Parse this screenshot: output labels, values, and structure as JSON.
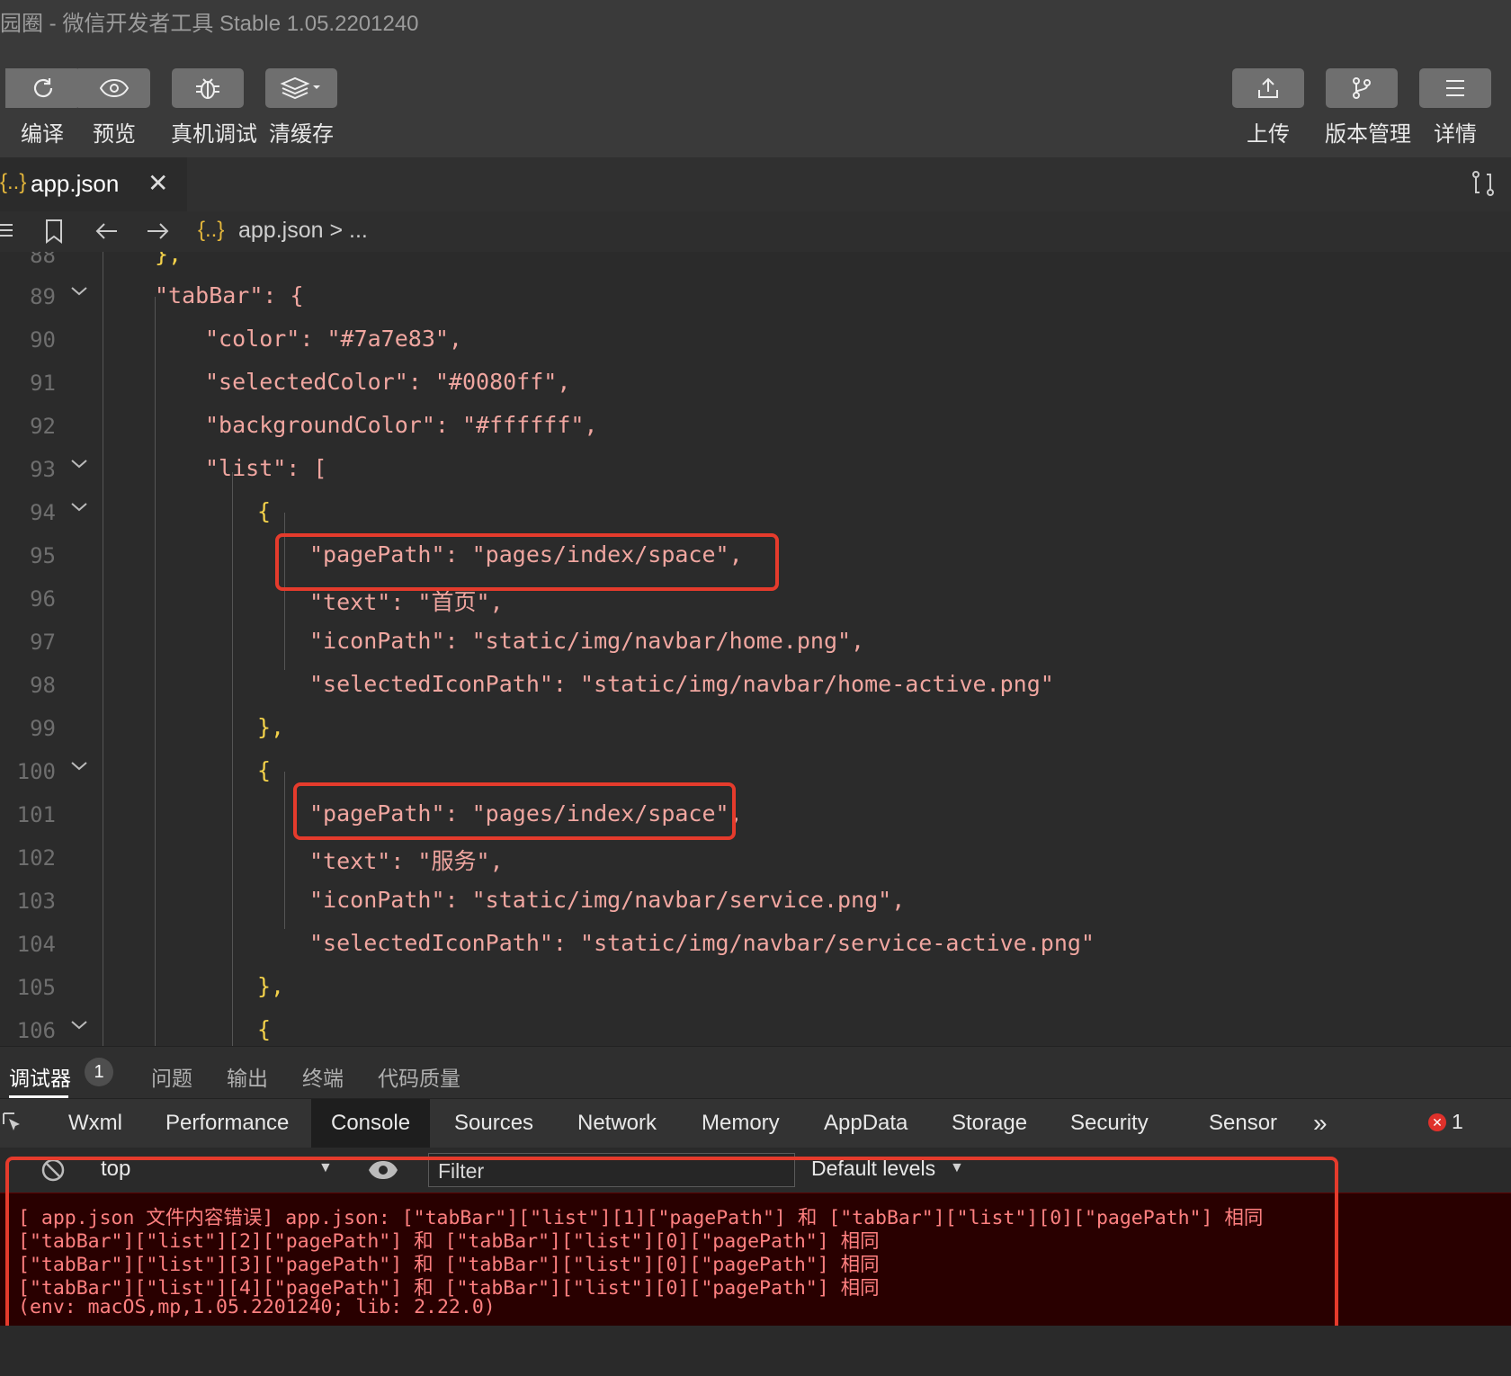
{
  "window": {
    "title": "园圈 - 微信开发者工具 Stable 1.05.2201240"
  },
  "toolbar": {
    "compile": "编译",
    "preview": "预览",
    "remote_debug": "真机调试",
    "clear_cache": "清缓存",
    "upload": "上传",
    "version": "版本管理",
    "details": "详情"
  },
  "file_tab": {
    "icon": "{..}",
    "name": "app.json"
  },
  "breadcrumb": {
    "icon": "{..}",
    "text": "app.json > ..."
  },
  "editor": {
    "lines": [
      {
        "num": "88",
        "code": "},"
      },
      {
        "num": "89",
        "code": "\"tabBar\": {"
      },
      {
        "num": "90",
        "code": "\"color\": \"#7a7e83\","
      },
      {
        "num": "91",
        "code": "\"selectedColor\": \"#0080ff\","
      },
      {
        "num": "92",
        "code": "\"backgroundColor\": \"#ffffff\","
      },
      {
        "num": "93",
        "code": "\"list\": ["
      },
      {
        "num": "94",
        "code": "{"
      },
      {
        "num": "95",
        "code": "\"pagePath\": \"pages/index/space\","
      },
      {
        "num": "96",
        "code": "\"text\": \"首页\","
      },
      {
        "num": "97",
        "code": "\"iconPath\": \"static/img/navbar/home.png\","
      },
      {
        "num": "98",
        "code": "\"selectedIconPath\": \"static/img/navbar/home-active.png\""
      },
      {
        "num": "99",
        "code": "},"
      },
      {
        "num": "100",
        "code": "{"
      },
      {
        "num": "101",
        "code": "\"pagePath\": \"pages/index/space\","
      },
      {
        "num": "102",
        "code": "\"text\": \"服务\","
      },
      {
        "num": "103",
        "code": "\"iconPath\": \"static/img/navbar/service.png\","
      },
      {
        "num": "104",
        "code": "\"selectedIconPath\": \"static/img/navbar/service-active.png\""
      },
      {
        "num": "105",
        "code": "},"
      },
      {
        "num": "106",
        "code": "{"
      }
    ]
  },
  "panel_tabs": {
    "debugger": "调试器",
    "debugger_badge": "1",
    "problems": "问题",
    "output": "输出",
    "terminal": "终端",
    "code_quality": "代码质量"
  },
  "devtools_tabs": {
    "wxml": "Wxml",
    "performance": "Performance",
    "console": "Console",
    "sources": "Sources",
    "network": "Network",
    "memory": "Memory",
    "appdata": "AppData",
    "storage": "Storage",
    "security": "Security",
    "sensor": "Sensor",
    "more": "»",
    "error_count": "1"
  },
  "console_filter": {
    "context": "top",
    "filter_placeholder": "Filter",
    "levels": "Default levels"
  },
  "console_messages": [
    "[ app.json 文件内容错误] app.json: [\"tabBar\"][\"list\"][1][\"pagePath\"] 和 [\"tabBar\"][\"list\"][0][\"pagePath\"] 相同",
    "[\"tabBar\"][\"list\"][2][\"pagePath\"] 和 [\"tabBar\"][\"list\"][0][\"pagePath\"] 相同",
    "[\"tabBar\"][\"list\"][3][\"pagePath\"] 和 [\"tabBar\"][\"list\"][0][\"pagePath\"] 相同",
    "[\"tabBar\"][\"list\"][4][\"pagePath\"] 和 [\"tabBar\"][\"list\"][0][\"pagePath\"] 相同",
    "(env: macOS,mp,1.05.2201240; lib: 2.22.0)"
  ],
  "colors": {
    "highlight_box": "#e53b2c",
    "error_bg": "#290000",
    "error_text": "#ff8080",
    "json_key": "#f0a6a0",
    "json_string": "#ee7d6f"
  }
}
